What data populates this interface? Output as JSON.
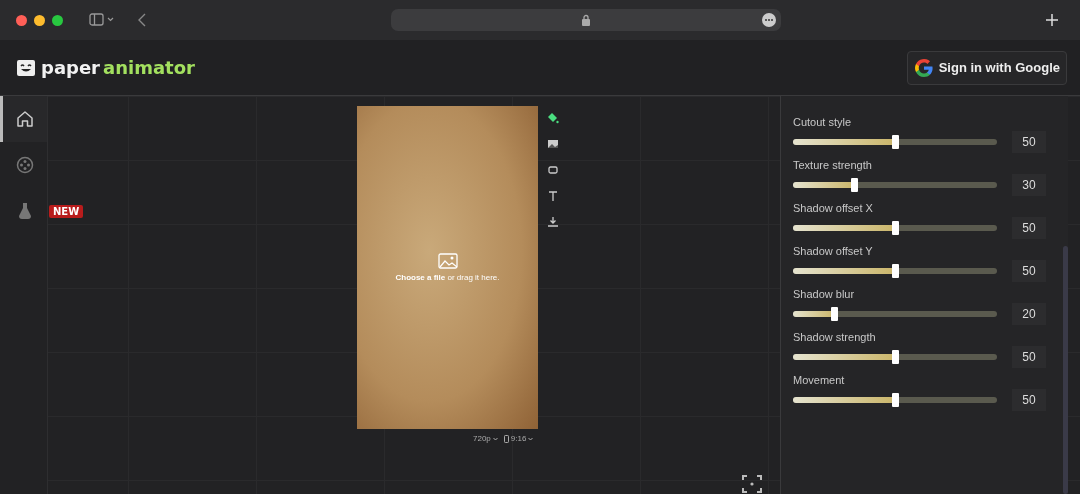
{
  "header": {
    "logo": {
      "part_1": "paper",
      "part_2": "animator"
    },
    "sign_in_button": "Sign in with Google"
  },
  "sidebar": {
    "items": [
      {
        "kind": "home",
        "selected": true
      },
      {
        "kind": "reel",
        "selected": false
      },
      {
        "kind": "flask",
        "selected": false,
        "badge": "NEW"
      }
    ]
  },
  "canvas": {
    "upload_prompt": {
      "link": "Choose a file",
      "rest": "or drag it here."
    },
    "resolution": "720p",
    "aspect": "9:16"
  },
  "settings": {
    "sliders": [
      {
        "label": "Cutout style",
        "level": 0.5,
        "value": "50"
      },
      {
        "label": "Texture strength",
        "level": 0.3,
        "value": "30"
      },
      {
        "label": "Shadow offset X",
        "level": 0.5,
        "value": "50"
      },
      {
        "label": "Shadow offset Y",
        "level": 0.5,
        "value": "50"
      },
      {
        "label": "Shadow blur",
        "level": 0.2,
        "value": "20"
      },
      {
        "label": "Shadow strength",
        "level": 0.5,
        "value": "50"
      },
      {
        "label": "Movement",
        "level": 0.5,
        "value": "50"
      }
    ]
  }
}
